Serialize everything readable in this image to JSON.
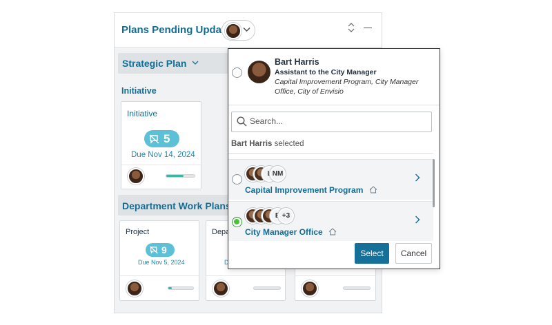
{
  "widget": {
    "title": "Plans Pending Updates",
    "collapse_icon": "collapse-icon",
    "minimize_icon": "minimize-icon"
  },
  "strategic_plan": {
    "label": "Strategic Plan",
    "sub_label": "Initiative",
    "card": {
      "title": "Initiative",
      "count": "5",
      "due": "Due Nov 14, 2024",
      "progress": 0.6
    }
  },
  "department_plans": {
    "label": "Department Work Plans",
    "cards": [
      {
        "title": "Project",
        "count": "9",
        "due": "Due Nov 5, 2024",
        "progress": 0.15
      },
      {
        "title": "Depa",
        "due": "D",
        "progress": 0
      },
      {
        "title": "",
        "progress": 0
      }
    ]
  },
  "dropdown": {
    "user": {
      "name": "Bart Harris",
      "role": "Assistant to the City Manager",
      "org": "Capital Improvement Program, City Manager Office, City of Envisio"
    },
    "search_placeholder": "Search...",
    "selected_name": "Bart Harris",
    "selected_suffix": "selected",
    "items": [
      {
        "label": "Capital Improvement Program",
        "avatars_text": [
          "L",
          "NM"
        ],
        "selected": false
      },
      {
        "label": "City Manager Office",
        "avatars_text": [
          "B",
          "+3"
        ],
        "selected": true
      }
    ],
    "select_label": "Select",
    "cancel_label": "Cancel"
  },
  "colors": {
    "accent": "#126d94",
    "badge": "#5cc0d6",
    "selected_radio": "#4fc03a",
    "primary_button": "#15709a"
  }
}
